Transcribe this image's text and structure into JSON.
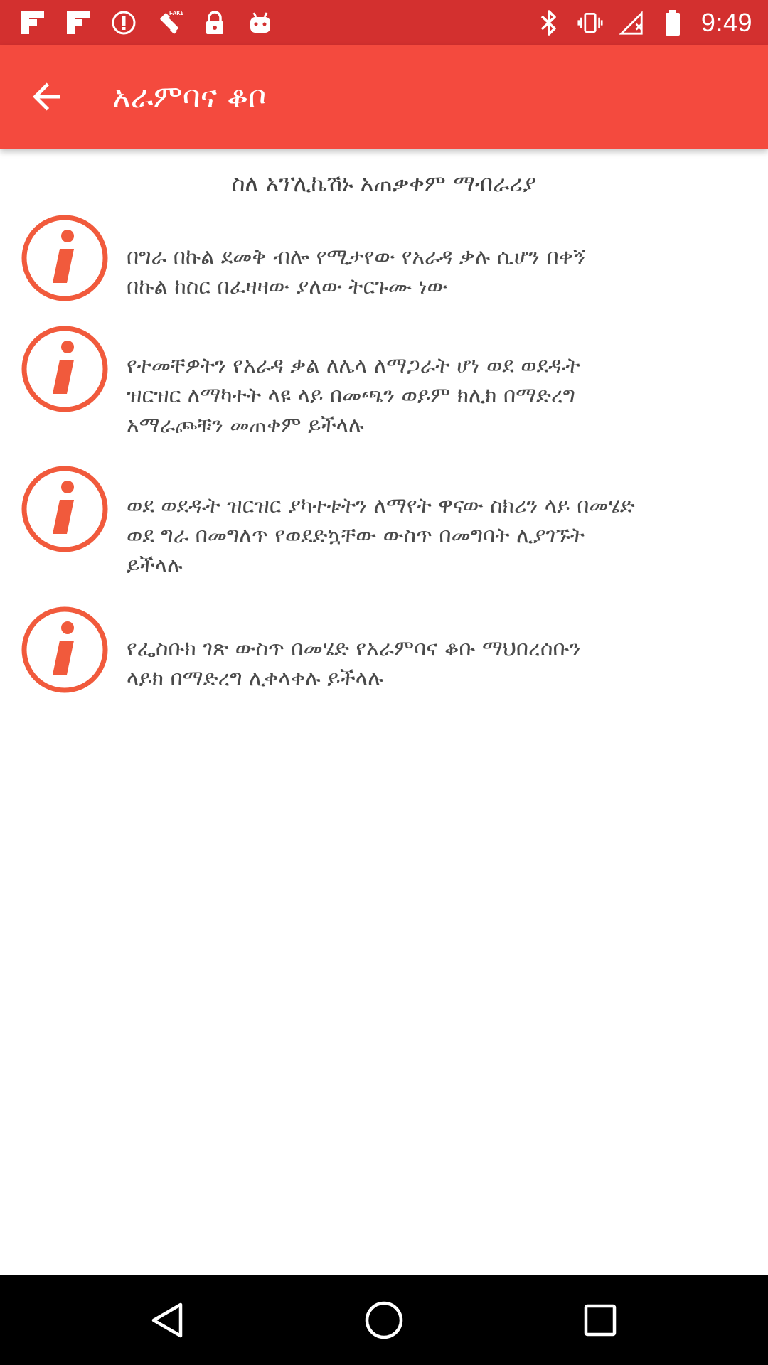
{
  "status_bar": {
    "time": "9:49",
    "left_icons": [
      "flipboard-icon",
      "flipboard-icon",
      "circle-info-icon",
      "fake-gps-icon",
      "lock-icon",
      "android-icon"
    ],
    "right_icons": [
      "bluetooth-icon",
      "vibrate-icon",
      "signal-off-icon",
      "battery-icon"
    ]
  },
  "app_bar": {
    "title": "አራምባና ቆቦ",
    "back_icon": "arrow-back-icon"
  },
  "main": {
    "heading": "ስለ አፕሊኬሽኑ አጠቃቀም ማብራሪያ",
    "items": [
      {
        "icon": "info-icon",
        "lines": [
          "በግራ በኩል ደመቅ ብሎ የሚታየው የአራዳ ቃሉ ሲሆን በቀኝ",
          "በኩል ከስር በፈዛዛው ያለው ትርጉሙ ነው"
        ]
      },
      {
        "icon": "info-icon",
        "lines": [
          "የተመቸዎትን የአራዳ ቃል ለሌላ ለማጋራት ሆነ ወደ ወደዱት",
          "ዝርዝር ለማካተት ላዩ ላይ በመጫን ወይም ክሊክ በማድረግ",
          "አማራጮቹን መጠቀም ይችላሉ"
        ]
      },
      {
        "icon": "info-icon",
        "lines": [
          "ወደ ወደዱት ዝርዝር ያካተቱትን ለማየት ዋናው ስክሪን ላይ በመሄድ",
          "ወደ ግራ በመግለጥ የወደድኳቸው ውስጥ በመግባት ሊያገኙት",
          "ይችላሉ"
        ]
      },
      {
        "icon": "info-icon",
        "lines": [
          "የፌስቡክ ገጽ ውስጥ በመሄድ የአራምባና ቆቡ ማህበረሰቡን",
          "ላይክ በማድረግ ሊቀላቀሉ ይችላሉ"
        ]
      }
    ]
  },
  "nav_bar": {
    "buttons": [
      "back-triangle-icon",
      "home-circle-icon",
      "recents-square-icon"
    ]
  },
  "colors": {
    "status_bar": "#d3302f",
    "app_bar": "#f44a3e",
    "info_accent": "#f15a3c",
    "text": "#4a4a4a"
  }
}
